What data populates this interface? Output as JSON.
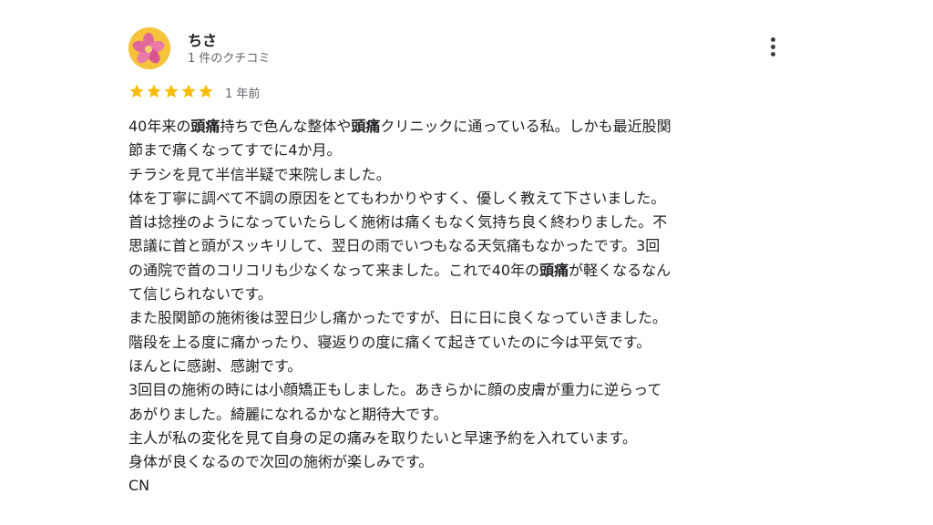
{
  "review": {
    "author": "ちさ",
    "author_meta": "1 件のクチコミ",
    "rating": 5,
    "rating_max": 5,
    "time_ago": "1 年前",
    "icons": {
      "star": "star-icon",
      "more": "more-vert-icon"
    },
    "colors": {
      "star": "#fbbc04",
      "avatar_bg": "#f6c33b",
      "avatar_flower": "#e2679b"
    },
    "lines": [
      [
        {
          "t": "40年来の"
        },
        {
          "t": "頭痛",
          "b": true
        },
        {
          "t": "持ちで色んな整体や"
        },
        {
          "t": "頭痛",
          "b": true
        },
        {
          "t": "クリニックに通っている私。しかも最近股関"
        }
      ],
      [
        {
          "t": "節まで痛くなってすでに4か月。"
        }
      ],
      [
        {
          "t": "チラシを見て半信半疑で来院しました。"
        }
      ],
      [
        {
          "t": "体を丁寧に調べて不調の原因をとてもわかりやすく、優しく教えて下さいました。"
        }
      ],
      [
        {
          "t": "首は捻挫のようになっていたらしく施術は痛くもなく気持ち良く終わりました。不"
        }
      ],
      [
        {
          "t": "思議に首と頭がスッキリして、翌日の雨でいつもなる天気痛もなかったです。3回"
        }
      ],
      [
        {
          "t": "の通院で首のコリコリも少なくなって来ました。これで40年の"
        },
        {
          "t": "頭痛",
          "b": true
        },
        {
          "t": "が軽くなるなん"
        }
      ],
      [
        {
          "t": "て信じられないです。"
        }
      ],
      [
        {
          "t": "また股関節の施術後は翌日少し痛かったですが、日に日に良くなっていきました。"
        }
      ],
      [
        {
          "t": "階段を上る度に痛かったり、寝返りの度に痛くて起きていたのに今は平気です。"
        }
      ],
      [
        {
          "t": "ほんとに感謝、感謝です。"
        }
      ],
      [
        {
          "t": "3回目の施術の時には小顔矯正もしました。あきらかに顔の皮膚が重力に逆らって"
        }
      ],
      [
        {
          "t": "あがりました。綺麗になれるかなと期待大です。"
        }
      ],
      [
        {
          "t": "主人が私の変化を見て自身の足の痛みを取りたいと早速予約を入れています。"
        }
      ],
      [
        {
          "t": "身体が良くなるので次回の施術が楽しみです。"
        }
      ],
      [
        {
          "t": "CN"
        }
      ]
    ]
  }
}
